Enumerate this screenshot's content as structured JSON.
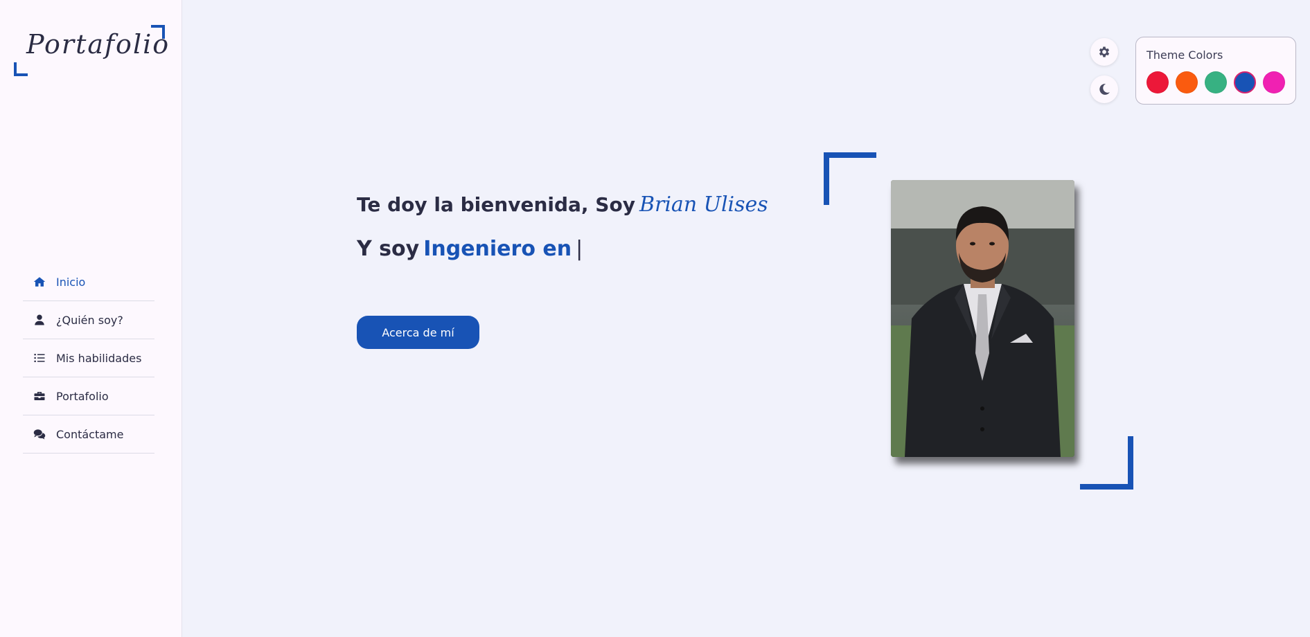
{
  "logo": {
    "text": "Portafolio"
  },
  "nav": {
    "items": [
      {
        "label": "Inicio",
        "icon": "home-icon",
        "active": true
      },
      {
        "label": "¿Quién soy?",
        "icon": "user-icon",
        "active": false
      },
      {
        "label": "Mis habilidades",
        "icon": "list-icon",
        "active": false
      },
      {
        "label": "Portafolio",
        "icon": "briefcase-icon",
        "active": false
      },
      {
        "label": "Contáctame",
        "icon": "comments-icon",
        "active": false
      }
    ]
  },
  "theme": {
    "title": "Theme Colors",
    "colors": [
      "#ec1839",
      "#fa5b0f",
      "#37b182",
      "#1853b5",
      "#f021b2"
    ],
    "selected": "#1853b5"
  },
  "hero": {
    "greeting": "Te doy la bienvenida, Soy",
    "name": "Brian Ulises",
    "prefix": "Y soy",
    "role": "Ingeniero en",
    "cursor": "|",
    "button_label": "Acerca de mí"
  },
  "colors": {
    "accent": "#1853b5",
    "sidebar_bg": "#fdf8fe",
    "page_bg": "#f1f2fb",
    "text": "#2b2c44"
  }
}
